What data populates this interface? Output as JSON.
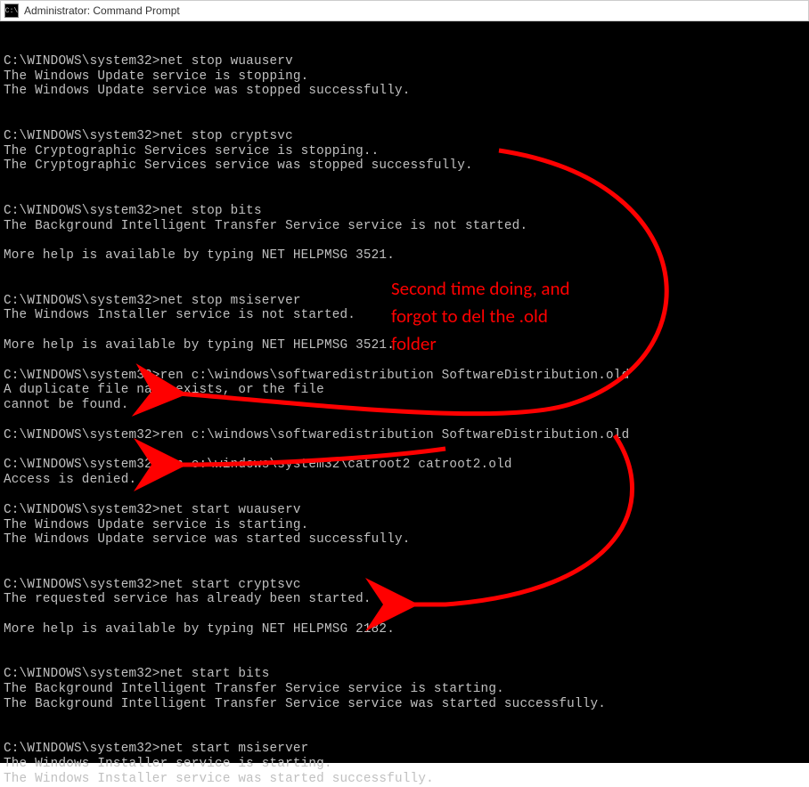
{
  "window": {
    "title": "Administrator: Command Prompt",
    "icon_label": "C:\\"
  },
  "prompt": "C:\\WINDOWS\\system32>",
  "terminal_lines": [
    "",
    "C:\\WINDOWS\\system32>net stop wuauserv",
    "The Windows Update service is stopping.",
    "The Windows Update service was stopped successfully.",
    "",
    "",
    "C:\\WINDOWS\\system32>net stop cryptsvc",
    "The Cryptographic Services service is stopping..",
    "The Cryptographic Services service was stopped successfully.",
    "",
    "",
    "C:\\WINDOWS\\system32>net stop bits",
    "The Background Intelligent Transfer Service service is not started.",
    "",
    "More help is available by typing NET HELPMSG 3521.",
    "",
    "",
    "C:\\WINDOWS\\system32>net stop msiserver",
    "The Windows Installer service is not started.",
    "",
    "More help is available by typing NET HELPMSG 3521.",
    "",
    "C:\\WINDOWS\\system32>ren c:\\windows\\softwaredistribution SoftwareDistribution.old",
    "A duplicate file name exists, or the file",
    "cannot be found.",
    "",
    "C:\\WINDOWS\\system32>ren c:\\windows\\softwaredistribution SoftwareDistribution.old",
    "",
    "C:\\WINDOWS\\system32>ren c:\\windows\\system32\\catroot2 catroot2.old",
    "Access is denied.",
    "",
    "C:\\WINDOWS\\system32>net start wuauserv",
    "The Windows Update service is starting.",
    "The Windows Update service was started successfully.",
    "",
    "",
    "C:\\WINDOWS\\system32>net start cryptsvc",
    "The requested service has already been started.",
    "",
    "More help is available by typing NET HELPMSG 2182.",
    "",
    "",
    "C:\\WINDOWS\\system32>net start bits",
    "The Background Intelligent Transfer Service service is starting.",
    "The Background Intelligent Transfer Service service was started successfully.",
    "",
    "",
    "C:\\WINDOWS\\system32>net start msiserver",
    "The Windows Installer service is starting.",
    "The Windows Installer service was started successfully."
  ],
  "annotation": {
    "text": "Second time doing, and\nforgot to del the .old\nfolder",
    "color": "#ff0000"
  }
}
